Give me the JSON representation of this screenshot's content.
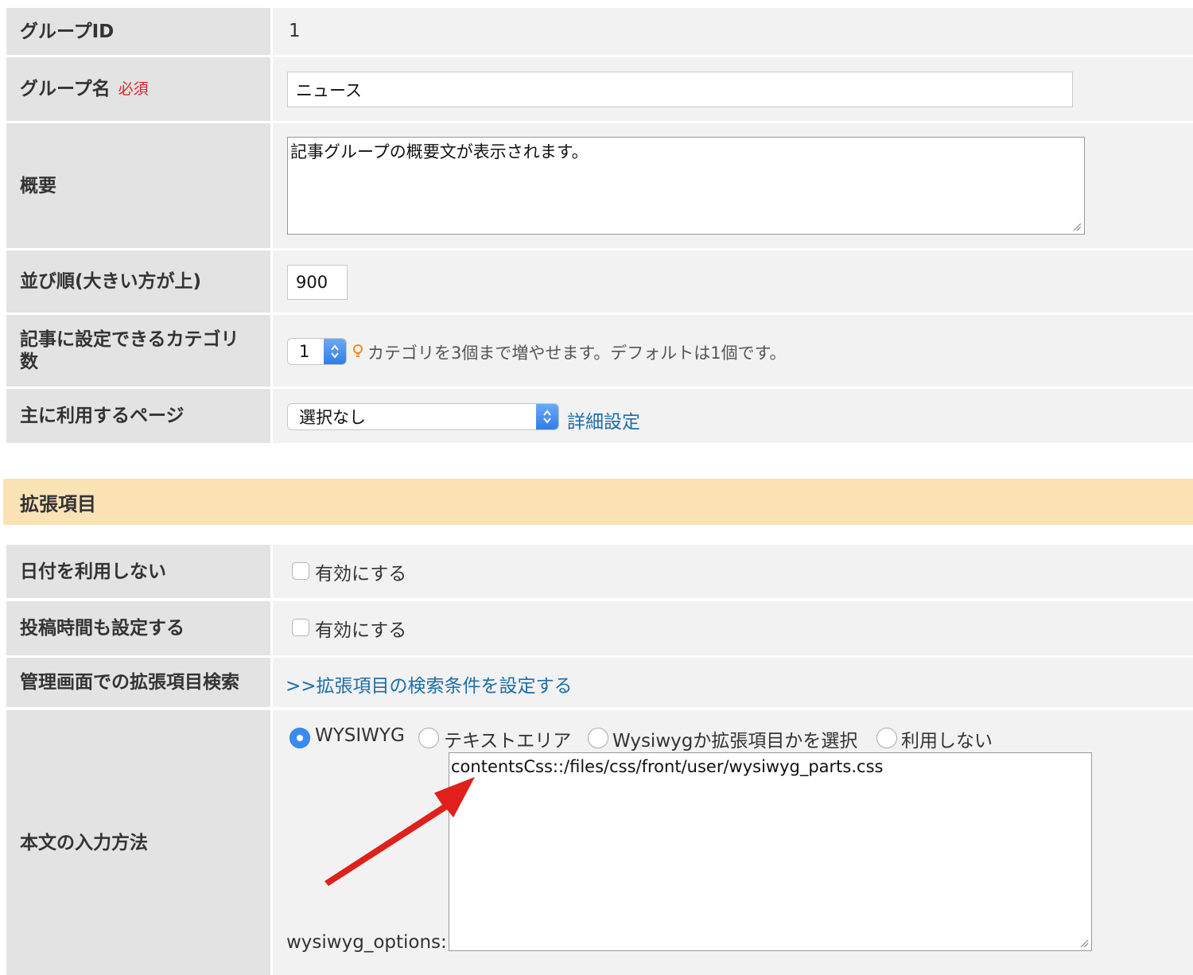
{
  "fields": {
    "group_id": {
      "label": "グループID",
      "value": "1"
    },
    "group_name": {
      "label": "グループ名",
      "required": "必須",
      "value": "ニュース"
    },
    "summary": {
      "label": "概要",
      "value": "記事グループの概要文が表示されます。"
    },
    "sort_order": {
      "label": "並び順(大きい方が上)",
      "value": "900"
    },
    "category_count": {
      "label_line1": "記事に設定できるカテゴリ",
      "label_line2": "数",
      "value": "1",
      "hint": "カテゴリを3個まで増やせます。デフォルトは1個です。"
    },
    "main_page": {
      "label": "主に利用するページ",
      "value": "選択なし",
      "link": "詳細設定"
    }
  },
  "extension_section": {
    "title": "拡張項目",
    "no_date": {
      "label": "日付を利用しない",
      "checkbox_label": "有効にする"
    },
    "post_time": {
      "label": "投稿時間も設定する",
      "checkbox_label": "有効にする"
    },
    "admin_search": {
      "label": "管理画面での拡張項目検索",
      "link": ">>拡張項目の検索条件を設定する"
    },
    "body_input": {
      "label": "本文の入力方法",
      "options": [
        "WYSIWYG",
        "テキストエリア",
        "Wysiwygか拡張項目かを選択",
        "利用しない"
      ],
      "selected": "WYSIWYG",
      "options_label": "wysiwyg_options:",
      "options_value": "contentsCss::/files/css/front/user/wysiwyg_parts.css"
    }
  },
  "colors": {
    "label_bg": "#e3e3e3",
    "cell_bg": "#f2f2f2",
    "section_bg": "#fbe3b6",
    "required": "#d9262f",
    "link": "#1e6ea7",
    "accent": "#3b8cf0",
    "arrow": "#e0201b"
  }
}
